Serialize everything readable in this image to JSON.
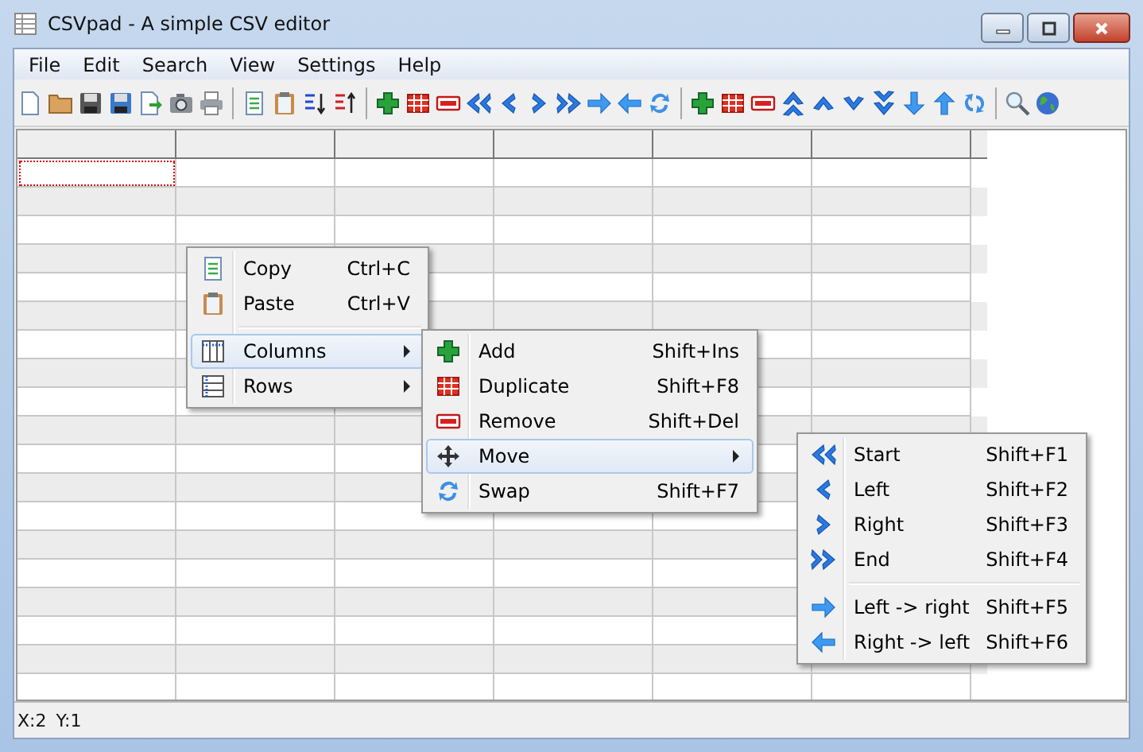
{
  "window": {
    "title": "CSVpad - A simple CSV editor"
  },
  "menu_bar": [
    "File",
    "Edit",
    "Search",
    "View",
    "Settings",
    "Help"
  ],
  "toolbar": [
    {
      "kind": "new"
    },
    {
      "kind": "open"
    },
    {
      "kind": "save"
    },
    {
      "kind": "save-as"
    },
    {
      "kind": "export"
    },
    {
      "kind": "camera"
    },
    {
      "kind": "print"
    },
    {
      "kind": "separator"
    },
    {
      "kind": "copy"
    },
    {
      "kind": "paste"
    },
    {
      "kind": "sort-asc"
    },
    {
      "kind": "sort-desc"
    },
    {
      "kind": "separator"
    },
    {
      "kind": "add"
    },
    {
      "kind": "duplicate"
    },
    {
      "kind": "remove"
    },
    {
      "kind": "move-start"
    },
    {
      "kind": "move-left"
    },
    {
      "kind": "move-right"
    },
    {
      "kind": "move-end"
    },
    {
      "kind": "arrow-right"
    },
    {
      "kind": "arrow-left"
    },
    {
      "kind": "swap"
    },
    {
      "kind": "separator"
    },
    {
      "kind": "add"
    },
    {
      "kind": "duplicate"
    },
    {
      "kind": "remove"
    },
    {
      "kind": "move-top"
    },
    {
      "kind": "move-up"
    },
    {
      "kind": "move-down"
    },
    {
      "kind": "move-bottom"
    },
    {
      "kind": "arrow-down"
    },
    {
      "kind": "arrow-up"
    },
    {
      "kind": "swap-vertical"
    },
    {
      "kind": "separator"
    },
    {
      "kind": "search"
    },
    {
      "kind": "globe"
    }
  ],
  "grid": {
    "columns": [
      {
        "selected": false
      },
      {
        "selected": false
      },
      {
        "selected": false
      },
      {
        "selected": false
      },
      {
        "selected": false
      },
      {
        "selected": false
      }
    ],
    "rows": [
      {
        "selected": true
      },
      {
        "selected": false
      },
      {
        "selected": false
      },
      {
        "selected": false
      },
      {
        "selected": false
      },
      {
        "selected": false
      },
      {
        "selected": false
      },
      {
        "selected": false
      },
      {
        "selected": false
      },
      {
        "selected": false
      },
      {
        "selected": false
      },
      {
        "selected": false
      },
      {
        "selected": false
      },
      {
        "selected": false
      },
      {
        "selected": false
      },
      {
        "selected": false
      },
      {
        "selected": false
      },
      {
        "selected": false
      },
      {
        "selected": false
      }
    ]
  },
  "context_menus": [
    {
      "items": [
        {
          "kind": "copy",
          "label": "Copy",
          "shortcut": "Ctrl+C",
          "selected": false,
          "submenu": false
        },
        {
          "kind": "paste",
          "label": "Paste",
          "shortcut": "Ctrl+V",
          "selected": false,
          "submenu": false
        },
        {
          "kind": "separator"
        },
        {
          "kind": "columns",
          "label": "Columns",
          "selected": true,
          "submenu": true
        },
        {
          "kind": "rows",
          "label": "Rows",
          "selected": false,
          "submenu": true
        }
      ]
    },
    {
      "items": [
        {
          "kind": "add",
          "label": "Add",
          "shortcut": "Shift+Ins",
          "selected": false,
          "submenu": false
        },
        {
          "kind": "duplicate",
          "label": "Duplicate",
          "shortcut": "Shift+F8",
          "selected": false,
          "submenu": false
        },
        {
          "kind": "remove",
          "label": "Remove",
          "shortcut": "Shift+Del",
          "selected": false,
          "submenu": false
        },
        {
          "kind": "move",
          "label": "Move",
          "selected": true,
          "submenu": true
        },
        {
          "kind": "swap",
          "label": "Swap",
          "shortcut": "Shift+F7",
          "selected": false,
          "submenu": false
        }
      ]
    },
    {
      "items": [
        {
          "kind": "move-start",
          "label": "Start",
          "shortcut": "Shift+F1",
          "selected": false,
          "submenu": false
        },
        {
          "kind": "move-left",
          "label": "Left",
          "shortcut": "Shift+F2",
          "selected": false,
          "submenu": false
        },
        {
          "kind": "move-right",
          "label": "Right",
          "shortcut": "Shift+F3",
          "selected": false,
          "submenu": false
        },
        {
          "kind": "move-end",
          "label": "End",
          "shortcut": "Shift+F4",
          "selected": false,
          "submenu": false
        },
        {
          "kind": "separator"
        },
        {
          "kind": "arrow-right",
          "label": "Left -> right",
          "shortcut": "Shift+F5",
          "selected": false,
          "submenu": false
        },
        {
          "kind": "arrow-left",
          "label": "Right -> left",
          "shortcut": "Shift+F6",
          "selected": false,
          "submenu": false
        }
      ]
    }
  ],
  "status_bar": [
    "X:2",
    "Y:1"
  ]
}
